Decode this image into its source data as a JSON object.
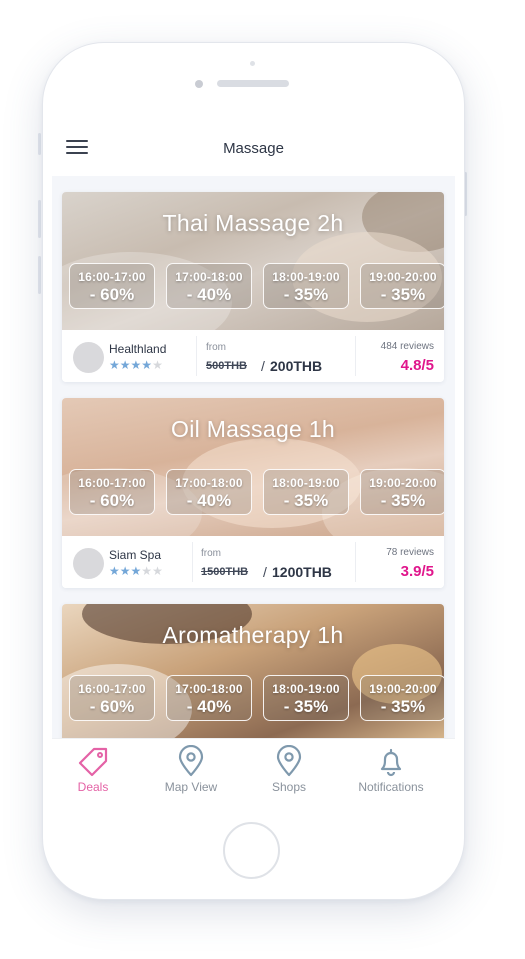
{
  "header": {
    "title": "Massage"
  },
  "deals": [
    {
      "title": "Thai Massage 2h",
      "slots": [
        {
          "time": "16:00-17:00",
          "discount": "- 60%"
        },
        {
          "time": "17:00-18:00",
          "discount": "- 40%"
        },
        {
          "time": "18:00-19:00",
          "discount": "- 35%"
        },
        {
          "time": "19:00-20:00",
          "discount": "- 35%"
        }
      ],
      "shop": "Healthland",
      "stars": 4,
      "from_label": "from",
      "old_price": "500THB",
      "separator": "/",
      "new_price": "200THB",
      "reviews": "484 reviews",
      "rating": "4.8/5"
    },
    {
      "title": "Oil Massage 1h",
      "slots": [
        {
          "time": "16:00-17:00",
          "discount": "- 60%"
        },
        {
          "time": "17:00-18:00",
          "discount": "- 40%"
        },
        {
          "time": "18:00-19:00",
          "discount": "- 35%"
        },
        {
          "time": "19:00-20:00",
          "discount": "- 35%"
        }
      ],
      "shop": "Siam Spa",
      "stars": 3,
      "from_label": "from",
      "old_price": "1500THB",
      "separator": "/",
      "new_price": "1200THB",
      "reviews": "78 reviews",
      "rating": "3.9/5"
    },
    {
      "title": "Aromatherapy 1h",
      "slots": [
        {
          "time": "16:00-17:00",
          "discount": "- 60%"
        },
        {
          "time": "17:00-18:00",
          "discount": "- 40%"
        },
        {
          "time": "18:00-19:00",
          "discount": "- 35%"
        },
        {
          "time": "19:00-20:00",
          "discount": "- 35%"
        }
      ]
    }
  ],
  "tabs": [
    {
      "label": "Deals",
      "icon": "tag-icon",
      "active": true
    },
    {
      "label": "Map View",
      "icon": "map-pin-icon",
      "active": false
    },
    {
      "label": "Shops",
      "icon": "map-pin-icon",
      "active": false
    },
    {
      "label": "Notifications",
      "icon": "bell-icon",
      "active": false
    }
  ],
  "colors": {
    "accent": "#e0168c",
    "active_tab": "#e462a6",
    "star": "#74a7d8",
    "icon": "#7f99ad"
  }
}
